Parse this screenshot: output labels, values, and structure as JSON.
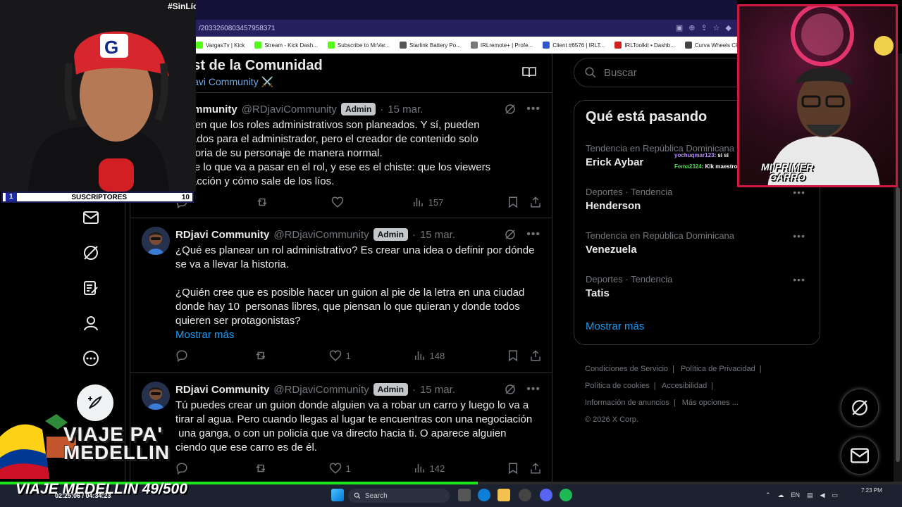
{
  "browser": {
    "url": "/2033260803457958371",
    "bookmarks": [
      {
        "label": "VargasTv | Kick",
        "color": "#53fc18"
      },
      {
        "label": "Stream - Kick Dash...",
        "color": "#53fc18"
      },
      {
        "label": "Subscribe to MrVar...",
        "color": "#53fc18"
      },
      {
        "label": "Starlink Battery Po...",
        "color": "#555555"
      },
      {
        "label": "IRLremote+ | Profe...",
        "color": "#777777"
      },
      {
        "label": "Client #6576 | IRLT...",
        "color": "#3355cc"
      },
      {
        "label": "IRLToolkit • Dashb...",
        "color": "#cc2222"
      },
      {
        "label": "Curva Wheels CFF76",
        "color": "#444444"
      }
    ]
  },
  "header": {
    "title": "ost de la Comunidad",
    "subtitle": "javi Community ⚔️"
  },
  "tweets": [
    {
      "name": "javi Community",
      "handle": "@RDjaviCommunity",
      "badge": "Admin",
      "dot": "·",
      "date": "15 mar.",
      "body": "bién dicen que los roles administrativos son planeados. Y sí, pueden\nr planeados para el administrador, pero el creador de contenido solo\ne la historia de su personaje de manera normal.\nNO sabe lo que va a pasar en el rol, y ese es el chiste: que los viewers\nn su reacción y cómo sale de los líos.",
      "more": "",
      "replies": "",
      "likes": "",
      "views": "157"
    },
    {
      "name": "RDjavi Community",
      "handle": "@RDjaviCommunity",
      "badge": "Admin",
      "dot": "·",
      "date": "15 mar.",
      "body": "¿Qué es planear un rol administrativo? Es crear una idea o definir por dónde\nse va a llevar la historia.\n\n¿Quién cree que es posible hacer un guion al pie de la letra en una ciudad\ndonde hay 10  personas libres, que piensan lo que quieran y donde todos\nquieren ser protagonistas?",
      "more": "Mostrar más",
      "replies": "",
      "likes": "1",
      "views": "148"
    },
    {
      "name": "RDjavi Community",
      "handle": "@RDjaviCommunity",
      "badge": "Admin",
      "dot": "·",
      "date": "15 mar.",
      "body": "Tú puedes crear un guion donde alguien va a robar un carro y luego lo va a\ntirar al agua. Pero cuando llegas al lugar te encuentras con una negociación\n una ganga, o con un policía que va directo hacia ti. O aparece alguien\nciendo que ese carro es de él.",
      "more": "",
      "replies": "",
      "likes": "1",
      "views": "142"
    }
  ],
  "search": {
    "placeholder": "Buscar"
  },
  "trends": {
    "title": "Qué está pasando",
    "items": [
      {
        "meta": "Tendencia en República Dominicana",
        "name": "Erick Aybar"
      },
      {
        "meta": "Deportes · Tendencia",
        "name": "Henderson"
      },
      {
        "meta": "Tendencia en República Dominicana",
        "name": "Venezuela"
      },
      {
        "meta": "Deportes · Tendencia",
        "name": "Tatis"
      }
    ],
    "show_more": "Mostrar más"
  },
  "footer": {
    "links": [
      "Condiciones de Servicio",
      "|",
      "Política de Privacidad",
      "|",
      "Política de cookies",
      "|",
      "Accesibilidad",
      "|",
      "Información de anuncios",
      "|",
      "Más opciones ...",
      "© 2026 X Corp."
    ]
  },
  "overlay": {
    "tag": "#SinLío",
    "subs_label": "SUSCRIPTORES",
    "subs_left": "1",
    "subs_right": "10",
    "chat": [
      {
        "user": "yochuqmar123",
        "msg": ": si si"
      },
      {
        "user": "Fema2324",
        "msg": ": Klk maestro"
      }
    ],
    "mi_carro": "MI PRIMER CARRO",
    "viaje_badge": "VIAJE PA' MEDELLIN",
    "viaje_status": "VIAJE MEDELLIN 49/500",
    "progress": 0.53,
    "media_time": "02:25:06 / 04:34:23"
  },
  "taskbar": {
    "search": "Search",
    "time": "7:23 PM"
  },
  "colors": {
    "accent": "#1d9bf0",
    "muted": "#71767b",
    "border": "#2f3336",
    "progress": "#19e519"
  }
}
